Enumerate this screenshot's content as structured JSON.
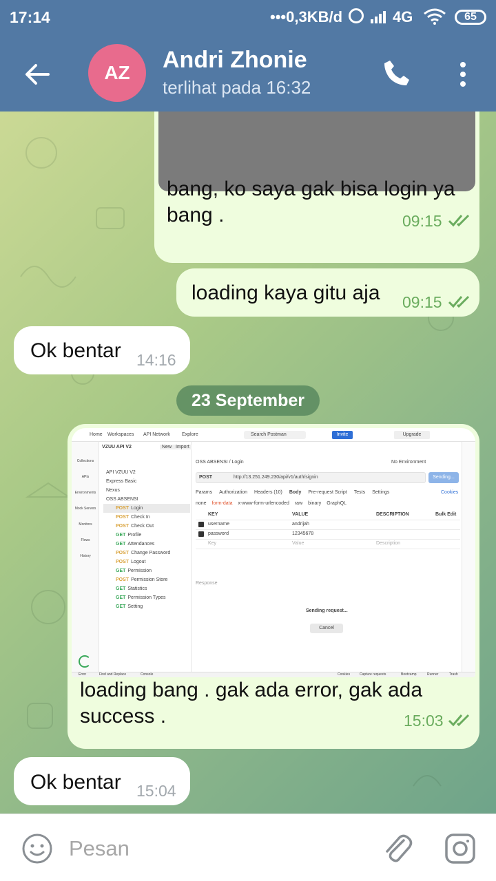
{
  "status_bar": {
    "time": "17:14",
    "network_speed": "•••0,3KB/d",
    "network_type": "4G",
    "battery": "65"
  },
  "header": {
    "avatar_initials": "AZ",
    "avatar_color": "#e86b8d",
    "contact_name": "Andri Zhonie",
    "last_seen": "terlihat pada  16:32",
    "header_color": "#5279a4"
  },
  "messages": [
    {
      "direction": "outgoing",
      "text": "bang, ko saya gak bisa login ya bang .",
      "time": "09:15",
      "read": true,
      "has_image": true
    },
    {
      "direction": "outgoing",
      "text": "loading kaya gitu aja",
      "time": "09:15",
      "read": true
    },
    {
      "direction": "incoming",
      "text": "Ok bentar",
      "time": "14:16"
    },
    {
      "direction": "outgoing",
      "text": "loading bang . gak ada error, gak ada success .",
      "time": "15:03",
      "read": true,
      "has_image": true
    },
    {
      "direction": "incoming",
      "text": "Ok bentar",
      "time": "15:04"
    }
  ],
  "date_separator": "23 September",
  "screenshot": {
    "nav": [
      "Home",
      "Workspaces",
      "API Network",
      "Explore"
    ],
    "search": "Search Postman",
    "invite": "Invite",
    "upgrade": "Upgrade",
    "workspace": "VZUU API V2",
    "new_label": "New",
    "import_label": "Import",
    "environment": "No Environment",
    "breadcrumb": "OSS ABSENSI / Login",
    "method": "POST",
    "url": "http://13.251.249.230/api/v1/auth/signin",
    "send": "Sending...",
    "tabs": [
      "Params",
      "Authorization",
      "Headers (10)",
      "Body",
      "Pre-request Script",
      "Tests",
      "Settings"
    ],
    "cookies": "Cookies",
    "body_types": [
      "none",
      "form-data",
      "x-www-form-urlencoded",
      "raw",
      "binary",
      "GraphQL"
    ],
    "columns": [
      "KEY",
      "VALUE",
      "DESCRIPTION"
    ],
    "bulk_edit": "Bulk Edit",
    "rows": [
      {
        "key": "username",
        "value": "andrijah"
      },
      {
        "key": "password",
        "value": "12345678"
      }
    ],
    "placeholder_key": "Key",
    "placeholder_value": "Value",
    "placeholder_desc": "Description",
    "tree": [
      {
        "label": "API VZUU V2"
      },
      {
        "label": "Express Basic"
      },
      {
        "label": "Nexus"
      },
      {
        "label": "OSS ABSENSI"
      },
      {
        "method": "POST",
        "label": "Login"
      },
      {
        "method": "POST",
        "label": "Check In"
      },
      {
        "method": "POST",
        "label": "Check Out"
      },
      {
        "method": "GET",
        "label": "Profile"
      },
      {
        "method": "GET",
        "label": "Attendances"
      },
      {
        "method": "POST",
        "label": "Change Password"
      },
      {
        "method": "POST",
        "label": "Logout"
      },
      {
        "method": "GET",
        "label": "Permission"
      },
      {
        "method": "POST",
        "label": "Permission Store"
      },
      {
        "method": "GET",
        "label": "Statistics"
      },
      {
        "method": "GET",
        "label": "Permission Types"
      },
      {
        "method": "GET",
        "label": "Setting"
      }
    ],
    "side_icons": [
      "Collections",
      "APIs",
      "Environments",
      "Mock Servers",
      "Monitors",
      "Flows",
      "History"
    ],
    "response_label": "Response",
    "sending_request": "Sending request...",
    "cancel": "Cancel",
    "footer": [
      "Error",
      "Find and Replace",
      "Console",
      "Cookies",
      "Capture requests",
      "Bootcamp",
      "Runner",
      "Trash"
    ]
  },
  "input": {
    "placeholder": "Pesan"
  }
}
